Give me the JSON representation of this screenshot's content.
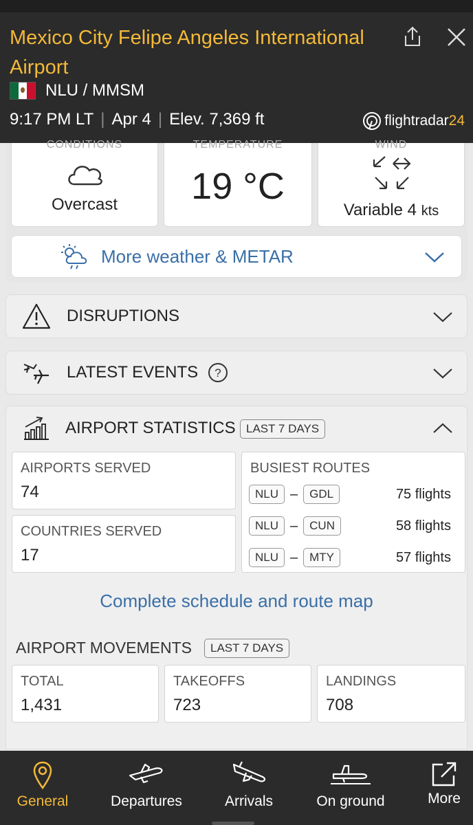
{
  "header": {
    "title": "Mexico City Felipe Angeles International Airport",
    "codes": "NLU / MMSM",
    "time": "9:17 PM LT",
    "date": "Apr 4",
    "elevation": "Elev. 7,369 ft",
    "brand": "flightradar",
    "brand_num": "24",
    "accent": "#f4b938"
  },
  "weather": {
    "conditions_label_cut": "CONDITIONS",
    "temperature_label_cut": "TEMPERATURE",
    "wind_label_cut": "WIND",
    "condition": "Overcast",
    "temperature": "19 °C",
    "wind_value": "Variable 4",
    "wind_unit": "kts",
    "more_label": "More weather & METAR"
  },
  "sections": {
    "disruptions": "DISRUPTIONS",
    "latest_events": "LATEST EVENTS",
    "airport_statistics": "AIRPORT STATISTICS",
    "period_badge": "LAST 7 DAYS"
  },
  "stats": {
    "airports_served_label": "AIRPORTS SERVED",
    "airports_served": "74",
    "countries_served_label": "COUNTRIES SERVED",
    "countries_served": "17",
    "busiest_routes_label": "BUSIEST ROUTES",
    "routes": [
      {
        "from": "NLU",
        "to": "GDL",
        "flights": "75 flights"
      },
      {
        "from": "NLU",
        "to": "CUN",
        "flights": "58 flights"
      },
      {
        "from": "NLU",
        "to": "MTY",
        "flights": "57 flights"
      }
    ],
    "schedule_link": "Complete schedule and route map"
  },
  "movements": {
    "label": "AIRPORT MOVEMENTS",
    "badge": "LAST 7 DAYS",
    "total_label": "TOTAL",
    "total": "1,431",
    "takeoffs_label": "TAKEOFFS",
    "takeoffs": "723",
    "landings_label": "LANDINGS",
    "landings": "708"
  },
  "nav": {
    "general": "General",
    "departures": "Departures",
    "arrivals": "Arrivals",
    "on_ground": "On ground",
    "more": "More"
  }
}
